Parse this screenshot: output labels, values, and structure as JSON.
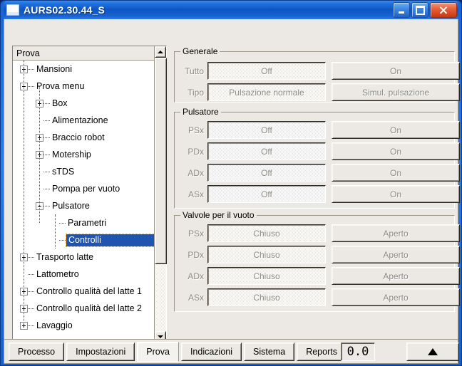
{
  "window": {
    "title": "AURS02.30.44_S",
    "icon": "window-icon",
    "buttons": {
      "minimize": "minimize-icon",
      "maximize": "maximize-icon",
      "close": "close-icon"
    }
  },
  "tree": {
    "header": "Prova",
    "nodes": [
      {
        "label": "Mansioni",
        "depth": 0,
        "toggle": "plus"
      },
      {
        "label": "Prova menu",
        "depth": 0,
        "toggle": "minus"
      },
      {
        "label": "Box",
        "depth": 1,
        "toggle": "plus"
      },
      {
        "label": "Alimentazione",
        "depth": 1,
        "toggle": "none"
      },
      {
        "label": "Braccio robot",
        "depth": 1,
        "toggle": "plus"
      },
      {
        "label": "Motership",
        "depth": 1,
        "toggle": "plus"
      },
      {
        "label": "sTDS",
        "depth": 1,
        "toggle": "none"
      },
      {
        "label": "Pompa per vuoto",
        "depth": 1,
        "toggle": "none"
      },
      {
        "label": "Pulsatore",
        "depth": 1,
        "toggle": "minus"
      },
      {
        "label": "Parametri",
        "depth": 2,
        "toggle": "none"
      },
      {
        "label": "Controlli",
        "depth": 2,
        "toggle": "none",
        "selected": true
      },
      {
        "label": "Trasporto latte",
        "depth": 0,
        "toggle": "plus"
      },
      {
        "label": "Lattometro",
        "depth": 0,
        "toggle": "none"
      },
      {
        "label": "Controllo qualità del latte 1",
        "depth": 0,
        "toggle": "plus"
      },
      {
        "label": "Controllo qualità del latte 2",
        "depth": 0,
        "toggle": "plus"
      },
      {
        "label": "Lavaggio",
        "depth": 0,
        "toggle": "plus"
      }
    ],
    "scrollbars": {
      "vertical_up": "scroll-up-icon",
      "vertical_down": "scroll-down-icon",
      "horizontal_left": "scroll-left-icon",
      "horizontal_right": "scroll-right-icon"
    }
  },
  "groups": [
    {
      "key": "generale",
      "title": "Generale",
      "rows": [
        {
          "label": "Tutto",
          "left": "Off",
          "right": "On",
          "left_state": "pressed"
        },
        {
          "label": "Tipo",
          "left": "Pulsazione normale",
          "right": "Simul. pulsazione",
          "left_state": "pressed"
        }
      ]
    },
    {
      "key": "pulsatore",
      "title": "Pulsatore",
      "rows": [
        {
          "label": "PSx",
          "left": "Off",
          "right": "On",
          "left_state": "pressed"
        },
        {
          "label": "PDx",
          "left": "Off",
          "right": "On",
          "left_state": "pressed"
        },
        {
          "label": "ADx",
          "left": "Off",
          "right": "On",
          "left_state": "pressed"
        },
        {
          "label": "ASx",
          "left": "Off",
          "right": "On",
          "left_state": "pressed"
        }
      ]
    },
    {
      "key": "valvole",
      "title": "Valvole per il vuoto",
      "rows": [
        {
          "label": "PSx",
          "left": "Chiuso",
          "right": "Aperto",
          "left_state": "pressed"
        },
        {
          "label": "PDx",
          "left": "Chiuso",
          "right": "Aperto",
          "left_state": "pressed"
        },
        {
          "label": "ADx",
          "left": "Chiuso",
          "right": "Aperto",
          "left_state": "pressed"
        },
        {
          "label": "ASx",
          "left": "Chiuso",
          "right": "Aperto",
          "left_state": "pressed"
        }
      ]
    }
  ],
  "bottom": {
    "tabs": [
      {
        "label": "Processo",
        "active": false
      },
      {
        "label": "Impostazioni",
        "active": false
      },
      {
        "label": "Prova",
        "active": true
      },
      {
        "label": "Indicazioni",
        "active": false
      },
      {
        "label": "Sistema",
        "active": false
      },
      {
        "label": "Reports",
        "active": false
      }
    ],
    "lcd_value": "0.0",
    "up_button_icon": "triangle-up-icon"
  },
  "colors": {
    "title_bar": "#0e55c4",
    "selection": "#1f55b0",
    "face": "#ece9e4",
    "close_button": "#c8370f"
  }
}
